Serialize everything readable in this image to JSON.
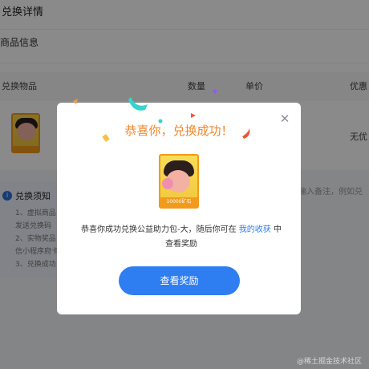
{
  "background": {
    "page_title": "兑换详情",
    "section_title": "商品信息",
    "table_headers": [
      "兑换物品",
      "数量",
      "单价",
      "优惠"
    ],
    "row": {
      "discount": "无优"
    },
    "thumb_label": "10000矿石",
    "notice": {
      "title": "兑换须知",
      "lines": [
        "1、虚拟商品",
        "发送兑换码",
        "2、实物奖品",
        "信小程序府卡",
        "3、兑换成功"
      ]
    },
    "remark_placeholder": "输入备注，例如兑"
  },
  "modal": {
    "title": "恭喜你，兑换成功！",
    "prize_label": "10000矿石",
    "message_before": "恭喜你成功兑换公益助力包-大，随后你可在",
    "message_link": "我的收获",
    "message_after": "中查看奖励",
    "button_label": "查看奖励"
  },
  "watermark": "@稀土掘金技术社区",
  "colors": {
    "accent": "#2e7ef2",
    "title_orange": "#f0862a",
    "prize_border": "#f29a1b"
  },
  "icons": {
    "close": "close-icon",
    "info": "info-icon"
  }
}
